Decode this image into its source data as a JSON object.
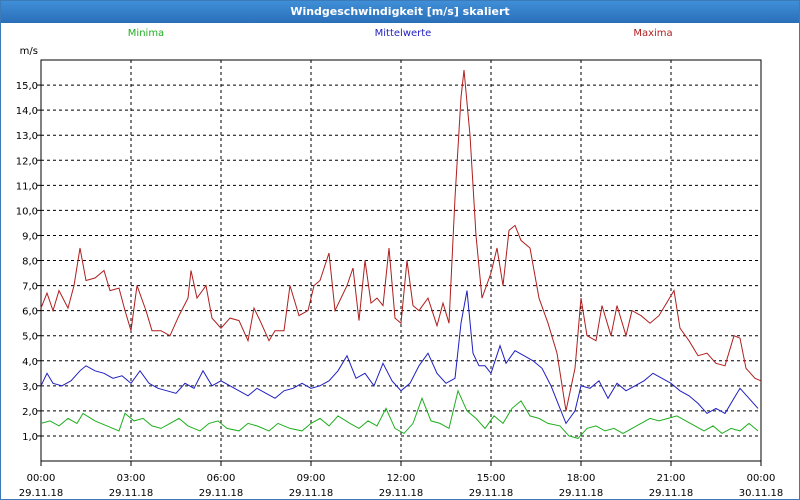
{
  "window": {
    "title": "Windgeschwindigkeit [m/s] skaliert"
  },
  "colors": {
    "minima": "#1fae1f",
    "mittelwerte": "#1f1fbf",
    "maxima": "#b01e1e",
    "grid": "#000000",
    "titlebar": "#2f7fcf"
  },
  "chart_data": {
    "type": "line",
    "title": "Windgeschwindigkeit [m/s] skaliert",
    "ylabel": "m/s",
    "xlabel": "",
    "ylim": [
      0,
      16
    ],
    "y_ticks": [
      {
        "value": 1,
        "label": "1,0"
      },
      {
        "value": 2,
        "label": "2,0"
      },
      {
        "value": 3,
        "label": "3,0"
      },
      {
        "value": 4,
        "label": "4,0"
      },
      {
        "value": 5,
        "label": "5,0"
      },
      {
        "value": 6,
        "label": "6,0"
      },
      {
        "value": 7,
        "label": "7,0"
      },
      {
        "value": 8,
        "label": "8,0"
      },
      {
        "value": 9,
        "label": "9,0"
      },
      {
        "value": 10,
        "label": "10,0"
      },
      {
        "value": 11,
        "label": "11,0"
      },
      {
        "value": 12,
        "label": "12,0"
      },
      {
        "value": 13,
        "label": "13,0"
      },
      {
        "value": 14,
        "label": "14,0"
      },
      {
        "value": 15,
        "label": "15,0"
      }
    ],
    "x_ticks": [
      {
        "hour": 0,
        "time": "00:00",
        "date": "29.11.18"
      },
      {
        "hour": 3,
        "time": "03:00",
        "date": "29.11.18"
      },
      {
        "hour": 6,
        "time": "06:00",
        "date": "29.11.18"
      },
      {
        "hour": 9,
        "time": "09:00",
        "date": "29.11.18"
      },
      {
        "hour": 12,
        "time": "12:00",
        "date": "29.11.18"
      },
      {
        "hour": 15,
        "time": "15:00",
        "date": "29.11.18"
      },
      {
        "hour": 18,
        "time": "18:00",
        "date": "29.11.18"
      },
      {
        "hour": 21,
        "time": "21:00",
        "date": "29.11.18"
      },
      {
        "hour": 24,
        "time": "00:00",
        "date": "30.11.18"
      }
    ],
    "xlim": [
      0,
      24
    ],
    "grid": true,
    "legend": "top",
    "series": [
      {
        "name": "Minima",
        "points": [
          [
            0,
            1.5
          ],
          [
            0.3,
            1.6
          ],
          [
            0.6,
            1.4
          ],
          [
            0.9,
            1.7
          ],
          [
            1.2,
            1.5
          ],
          [
            1.4,
            1.9
          ],
          [
            1.8,
            1.6
          ],
          [
            2.2,
            1.4
          ],
          [
            2.6,
            1.2
          ],
          [
            2.8,
            1.9
          ],
          [
            3.1,
            1.6
          ],
          [
            3.4,
            1.7
          ],
          [
            3.7,
            1.4
          ],
          [
            4.0,
            1.3
          ],
          [
            4.3,
            1.5
          ],
          [
            4.6,
            1.7
          ],
          [
            4.9,
            1.4
          ],
          [
            5.3,
            1.2
          ],
          [
            5.6,
            1.5
          ],
          [
            5.9,
            1.6
          ],
          [
            6.2,
            1.3
          ],
          [
            6.6,
            1.2
          ],
          [
            6.9,
            1.5
          ],
          [
            7.2,
            1.4
          ],
          [
            7.6,
            1.2
          ],
          [
            7.9,
            1.5
          ],
          [
            8.3,
            1.3
          ],
          [
            8.7,
            1.2
          ],
          [
            9.0,
            1.5
          ],
          [
            9.3,
            1.7
          ],
          [
            9.6,
            1.4
          ],
          [
            9.9,
            1.8
          ],
          [
            10.3,
            1.5
          ],
          [
            10.6,
            1.3
          ],
          [
            10.9,
            1.6
          ],
          [
            11.2,
            1.4
          ],
          [
            11.5,
            2.1
          ],
          [
            11.8,
            1.3
          ],
          [
            12.1,
            1.1
          ],
          [
            12.4,
            1.5
          ],
          [
            12.7,
            2.5
          ],
          [
            13.0,
            1.6
          ],
          [
            13.3,
            1.5
          ],
          [
            13.6,
            1.3
          ],
          [
            13.9,
            2.8
          ],
          [
            14.2,
            2.0
          ],
          [
            14.5,
            1.7
          ],
          [
            14.8,
            1.3
          ],
          [
            15.1,
            1.8
          ],
          [
            15.4,
            1.5
          ],
          [
            15.7,
            2.1
          ],
          [
            16.0,
            2.4
          ],
          [
            16.3,
            1.8
          ],
          [
            16.6,
            1.7
          ],
          [
            16.9,
            1.5
          ],
          [
            17.3,
            1.4
          ],
          [
            17.6,
            1.0
          ],
          [
            17.9,
            0.9
          ],
          [
            18.2,
            1.3
          ],
          [
            18.5,
            1.4
          ],
          [
            18.8,
            1.2
          ],
          [
            19.1,
            1.3
          ],
          [
            19.4,
            1.1
          ],
          [
            19.7,
            1.3
          ],
          [
            20.0,
            1.5
          ],
          [
            20.3,
            1.7
          ],
          [
            20.6,
            1.6
          ],
          [
            20.9,
            1.7
          ],
          [
            21.2,
            1.8
          ],
          [
            21.5,
            1.6
          ],
          [
            21.8,
            1.4
          ],
          [
            22.1,
            1.2
          ],
          [
            22.4,
            1.4
          ],
          [
            22.7,
            1.1
          ],
          [
            23.0,
            1.3
          ],
          [
            23.3,
            1.2
          ],
          [
            23.6,
            1.5
          ],
          [
            23.9,
            1.2
          ]
        ]
      },
      {
        "name": "Mittelwerte",
        "points": [
          [
            0,
            3.0
          ],
          [
            0.2,
            3.5
          ],
          [
            0.4,
            3.1
          ],
          [
            0.7,
            3.0
          ],
          [
            1.0,
            3.2
          ],
          [
            1.3,
            3.6
          ],
          [
            1.5,
            3.8
          ],
          [
            1.8,
            3.6
          ],
          [
            2.1,
            3.5
          ],
          [
            2.4,
            3.3
          ],
          [
            2.7,
            3.4
          ],
          [
            3.0,
            3.1
          ],
          [
            3.3,
            3.6
          ],
          [
            3.6,
            3.1
          ],
          [
            3.9,
            2.9
          ],
          [
            4.2,
            2.8
          ],
          [
            4.5,
            2.7
          ],
          [
            4.8,
            3.1
          ],
          [
            5.1,
            2.9
          ],
          [
            5.4,
            3.6
          ],
          [
            5.7,
            3.0
          ],
          [
            6.0,
            3.2
          ],
          [
            6.3,
            3.0
          ],
          [
            6.6,
            2.8
          ],
          [
            6.9,
            2.6
          ],
          [
            7.2,
            2.9
          ],
          [
            7.5,
            2.7
          ],
          [
            7.8,
            2.5
          ],
          [
            8.1,
            2.8
          ],
          [
            8.4,
            2.9
          ],
          [
            8.7,
            3.1
          ],
          [
            9.0,
            2.9
          ],
          [
            9.3,
            3.0
          ],
          [
            9.6,
            3.2
          ],
          [
            9.9,
            3.6
          ],
          [
            10.2,
            4.2
          ],
          [
            10.5,
            3.3
          ],
          [
            10.8,
            3.5
          ],
          [
            11.1,
            3.0
          ],
          [
            11.4,
            3.9
          ],
          [
            11.7,
            3.2
          ],
          [
            12.0,
            2.8
          ],
          [
            12.3,
            3.1
          ],
          [
            12.6,
            3.8
          ],
          [
            12.9,
            4.3
          ],
          [
            13.2,
            3.5
          ],
          [
            13.5,
            3.1
          ],
          [
            13.8,
            3.3
          ],
          [
            14.0,
            5.5
          ],
          [
            14.2,
            6.8
          ],
          [
            14.4,
            4.3
          ],
          [
            14.6,
            3.8
          ],
          [
            14.8,
            3.8
          ],
          [
            15.0,
            3.5
          ],
          [
            15.3,
            4.6
          ],
          [
            15.5,
            3.9
          ],
          [
            15.8,
            4.4
          ],
          [
            16.1,
            4.2
          ],
          [
            16.4,
            4.0
          ],
          [
            16.7,
            3.7
          ],
          [
            17.0,
            3.0
          ],
          [
            17.3,
            2.1
          ],
          [
            17.5,
            1.5
          ],
          [
            17.8,
            2.0
          ],
          [
            18.0,
            3.0
          ],
          [
            18.3,
            2.9
          ],
          [
            18.6,
            3.2
          ],
          [
            18.9,
            2.5
          ],
          [
            19.2,
            3.1
          ],
          [
            19.5,
            2.8
          ],
          [
            19.8,
            3.0
          ],
          [
            20.1,
            3.2
          ],
          [
            20.4,
            3.5
          ],
          [
            20.7,
            3.3
          ],
          [
            21.0,
            3.1
          ],
          [
            21.3,
            2.8
          ],
          [
            21.6,
            2.6
          ],
          [
            21.9,
            2.3
          ],
          [
            22.2,
            1.9
          ],
          [
            22.5,
            2.1
          ],
          [
            22.8,
            1.9
          ],
          [
            23.1,
            2.5
          ],
          [
            23.3,
            2.9
          ],
          [
            23.6,
            2.5
          ],
          [
            23.9,
            2.1
          ]
        ]
      },
      {
        "name": "Maxima",
        "points": [
          [
            0,
            6.1
          ],
          [
            0.2,
            6.7
          ],
          [
            0.4,
            6.0
          ],
          [
            0.6,
            6.8
          ],
          [
            0.9,
            6.1
          ],
          [
            1.1,
            7.0
          ],
          [
            1.3,
            8.5
          ],
          [
            1.5,
            7.2
          ],
          [
            1.8,
            7.3
          ],
          [
            2.1,
            7.6
          ],
          [
            2.3,
            6.8
          ],
          [
            2.6,
            6.9
          ],
          [
            2.8,
            6.0
          ],
          [
            3.0,
            5.2
          ],
          [
            3.2,
            7.0
          ],
          [
            3.5,
            6.0
          ],
          [
            3.7,
            5.2
          ],
          [
            4.0,
            5.2
          ],
          [
            4.3,
            5.0
          ],
          [
            4.6,
            5.8
          ],
          [
            4.9,
            6.5
          ],
          [
            5.0,
            7.6
          ],
          [
            5.2,
            6.5
          ],
          [
            5.5,
            7.0
          ],
          [
            5.7,
            5.7
          ],
          [
            6.0,
            5.3
          ],
          [
            6.3,
            5.7
          ],
          [
            6.6,
            5.6
          ],
          [
            6.9,
            4.8
          ],
          [
            7.1,
            6.1
          ],
          [
            7.3,
            5.6
          ],
          [
            7.6,
            4.8
          ],
          [
            7.8,
            5.2
          ],
          [
            8.1,
            5.2
          ],
          [
            8.3,
            7.0
          ],
          [
            8.6,
            5.8
          ],
          [
            8.9,
            6.0
          ],
          [
            9.1,
            7.0
          ],
          [
            9.3,
            7.2
          ],
          [
            9.6,
            8.3
          ],
          [
            9.8,
            6.0
          ],
          [
            10.0,
            6.5
          ],
          [
            10.2,
            7.0
          ],
          [
            10.4,
            7.7
          ],
          [
            10.6,
            5.6
          ],
          [
            10.8,
            8.0
          ],
          [
            11.0,
            6.3
          ],
          [
            11.2,
            6.5
          ],
          [
            11.4,
            6.2
          ],
          [
            11.6,
            8.5
          ],
          [
            11.8,
            5.7
          ],
          [
            12.0,
            5.5
          ],
          [
            12.2,
            8.0
          ],
          [
            12.4,
            6.2
          ],
          [
            12.6,
            6.0
          ],
          [
            12.9,
            6.5
          ],
          [
            13.2,
            5.4
          ],
          [
            13.4,
            6.3
          ],
          [
            13.6,
            5.5
          ],
          [
            13.8,
            10.5
          ],
          [
            14.0,
            14.5
          ],
          [
            14.1,
            15.6
          ],
          [
            14.3,
            13.0
          ],
          [
            14.5,
            9.0
          ],
          [
            14.7,
            6.5
          ],
          [
            15.0,
            7.5
          ],
          [
            15.2,
            8.5
          ],
          [
            15.4,
            7.0
          ],
          [
            15.6,
            9.2
          ],
          [
            15.8,
            9.4
          ],
          [
            16.0,
            8.8
          ],
          [
            16.3,
            8.5
          ],
          [
            16.6,
            6.5
          ],
          [
            16.9,
            5.5
          ],
          [
            17.2,
            4.3
          ],
          [
            17.5,
            2.0
          ],
          [
            17.8,
            3.7
          ],
          [
            18.0,
            6.5
          ],
          [
            18.2,
            5.0
          ],
          [
            18.5,
            4.8
          ],
          [
            18.7,
            6.2
          ],
          [
            19.0,
            5.0
          ],
          [
            19.2,
            6.2
          ],
          [
            19.5,
            5.0
          ],
          [
            19.7,
            6.0
          ],
          [
            20.0,
            5.8
          ],
          [
            20.3,
            5.5
          ],
          [
            20.6,
            5.8
          ],
          [
            20.9,
            6.4
          ],
          [
            21.1,
            6.8
          ],
          [
            21.3,
            5.3
          ],
          [
            21.6,
            4.8
          ],
          [
            21.9,
            4.2
          ],
          [
            22.2,
            4.3
          ],
          [
            22.5,
            3.9
          ],
          [
            22.8,
            3.8
          ],
          [
            23.1,
            5.0
          ],
          [
            23.3,
            4.9
          ],
          [
            23.5,
            3.7
          ],
          [
            23.8,
            3.3
          ],
          [
            24.0,
            3.2
          ]
        ]
      }
    ]
  }
}
